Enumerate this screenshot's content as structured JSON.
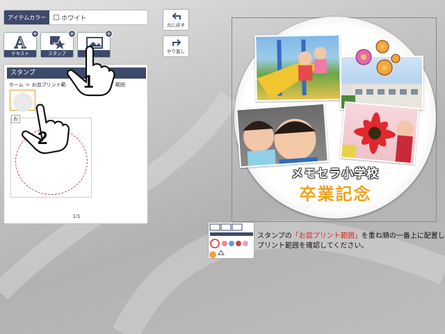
{
  "item_color": {
    "label": "アイテムカラー",
    "value": "ホワイト"
  },
  "tools": [
    {
      "label": "テキスト"
    },
    {
      "label": "スタンプ"
    },
    {
      "label": ""
    }
  ],
  "undo": {
    "label": "元に戻す"
  },
  "redo": {
    "label": "やり直し"
  },
  "stamp_panel": {
    "title": "スタンプ",
    "breadcrumb_home": "ホーム",
    "breadcrumb_sep": ">",
    "breadcrumb_current": "お皿プリント範",
    "breadcrumb_tail": "範囲",
    "tooltip": "お",
    "pager": "1/1"
  },
  "design": {
    "school_name": "メモセラ小学校",
    "event": "卒業記念"
  },
  "instruction": {
    "line1_pre": "スタンプの",
    "line1_highlight": "「お皿プリント範囲」",
    "line1_post": "を重ね順の一番上に配置し",
    "line2": "プリント範囲を確認してください。"
  },
  "step_numbers": {
    "first": "1",
    "second": "2"
  }
}
